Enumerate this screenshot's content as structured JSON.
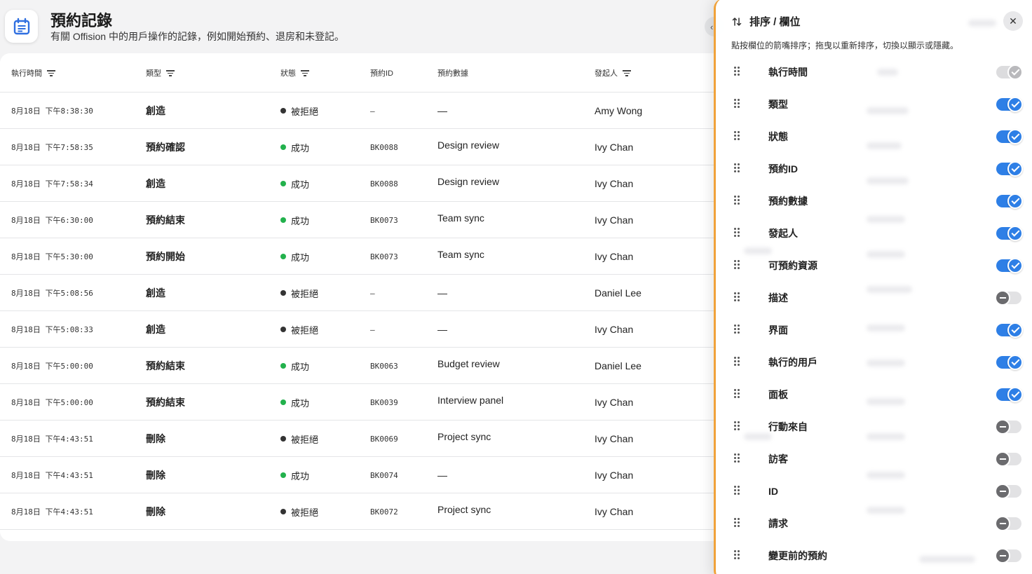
{
  "header": {
    "icon": "calendar-icon",
    "title": "預約記錄",
    "subtitle": "有關 Offision 中的用戶操作的記錄，例如開始預約、退房和未登記。"
  },
  "table": {
    "columns": [
      {
        "label": "執行時間",
        "filter": true
      },
      {
        "label": "類型",
        "filter": true
      },
      {
        "label": "狀態",
        "filter": true
      },
      {
        "label": "預約ID",
        "filter": false
      },
      {
        "label": "預約數據",
        "filter": false
      },
      {
        "label": "發起人",
        "filter": true
      }
    ],
    "rows": [
      {
        "time": "8月18日 下午8:38:30",
        "type": "創造",
        "status": "被拒絕",
        "status_kind": "rejected",
        "booking_id": "–",
        "booking_data": "—",
        "initiator": "Amy Wong"
      },
      {
        "time": "8月18日 下午7:58:35",
        "type": "預約確認",
        "status": "成功",
        "status_kind": "success",
        "booking_id": "BK0088",
        "booking_data": "Design review",
        "initiator": "Ivy Chan"
      },
      {
        "time": "8月18日 下午7:58:34",
        "type": "創造",
        "status": "成功",
        "status_kind": "success",
        "booking_id": "BK0088",
        "booking_data": "Design review",
        "initiator": "Ivy Chan"
      },
      {
        "time": "8月18日 下午6:30:00",
        "type": "預約結束",
        "status": "成功",
        "status_kind": "success",
        "booking_id": "BK0073",
        "booking_data": "Team sync",
        "initiator": "Ivy Chan"
      },
      {
        "time": "8月18日 下午5:30:00",
        "type": "預約開始",
        "status": "成功",
        "status_kind": "success",
        "booking_id": "BK0073",
        "booking_data": "Team sync",
        "initiator": "Ivy Chan"
      },
      {
        "time": "8月18日 下午5:08:56",
        "type": "創造",
        "status": "被拒絕",
        "status_kind": "rejected",
        "booking_id": "–",
        "booking_data": "—",
        "initiator": "Daniel Lee"
      },
      {
        "time": "8月18日 下午5:08:33",
        "type": "創造",
        "status": "被拒絕",
        "status_kind": "rejected",
        "booking_id": "–",
        "booking_data": "—",
        "initiator": "Ivy Chan"
      },
      {
        "time": "8月18日 下午5:00:00",
        "type": "預約結束",
        "status": "成功",
        "status_kind": "success",
        "booking_id": "BK0063",
        "booking_data": "Budget review",
        "initiator": "Daniel Lee"
      },
      {
        "time": "8月18日 下午5:00:00",
        "type": "預約結束",
        "status": "成功",
        "status_kind": "success",
        "booking_id": "BK0039",
        "booking_data": "Interview panel",
        "initiator": "Ivy Chan"
      },
      {
        "time": "8月18日 下午4:43:51",
        "type": "刪除",
        "status": "被拒絕",
        "status_kind": "rejected",
        "booking_id": "BK0069",
        "booking_data": "Project sync",
        "initiator": "Ivy Chan"
      },
      {
        "time": "8月18日 下午4:43:51",
        "type": "刪除",
        "status": "成功",
        "status_kind": "success",
        "booking_id": "BK0074",
        "booking_data": "—",
        "initiator": "Ivy Chan"
      },
      {
        "time": "8月18日 下午4:43:51",
        "type": "刪除",
        "status": "被拒絕",
        "status_kind": "rejected",
        "booking_id": "BK0072",
        "booking_data": "Project sync",
        "initiator": "Ivy Chan"
      }
    ]
  },
  "panel": {
    "title": "排序 / 欄位",
    "icon": "sort-icon",
    "close_icon": "close-icon",
    "hint": "點按欄位的箭嘴排序；拖曳以重新排序，切換以顯示或隱藏。",
    "columns": [
      {
        "label": "執行時間",
        "state": "locked"
      },
      {
        "label": "類型",
        "state": "on"
      },
      {
        "label": "狀態",
        "state": "on"
      },
      {
        "label": "預約ID",
        "state": "on"
      },
      {
        "label": "預約數據",
        "state": "on"
      },
      {
        "label": "發起人",
        "state": "on"
      },
      {
        "label": "可預約資源",
        "state": "on"
      },
      {
        "label": "描述",
        "state": "off"
      },
      {
        "label": "界面",
        "state": "on"
      },
      {
        "label": "執行的用戶",
        "state": "on"
      },
      {
        "label": "面板",
        "state": "on"
      },
      {
        "label": "行動來自",
        "state": "off"
      },
      {
        "label": "訪客",
        "state": "off"
      },
      {
        "label": "ID",
        "state": "off"
      },
      {
        "label": "請求",
        "state": "off"
      },
      {
        "label": "變更前的預約",
        "state": "off"
      }
    ]
  },
  "colors": {
    "accent": "#2e7fe6",
    "success": "#22b14c",
    "rejected": "#333333",
    "panel_border": "#f0a23a"
  }
}
